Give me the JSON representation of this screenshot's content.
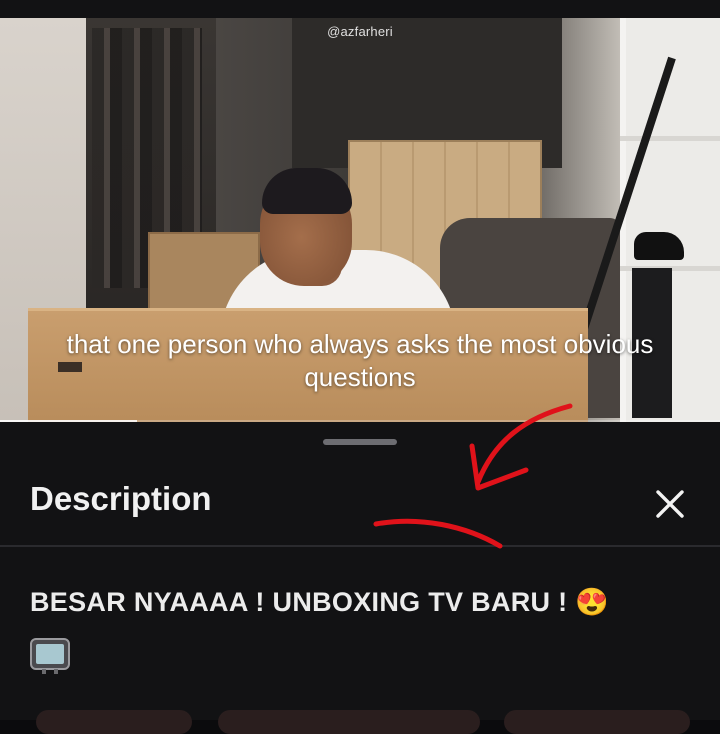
{
  "video": {
    "watermark": "@azfarheri",
    "caption": "that one person who always asks the most obvious questions",
    "progress": 0.19
  },
  "sheet": {
    "title": "Description",
    "close_icon": "close-icon",
    "description": "BESAR NYAAAA ! UNBOXING TV BARU ! 😍",
    "emoji": "tv-icon"
  },
  "colors": {
    "sheet_bg": "#121214",
    "annotation": "#e0121a"
  }
}
